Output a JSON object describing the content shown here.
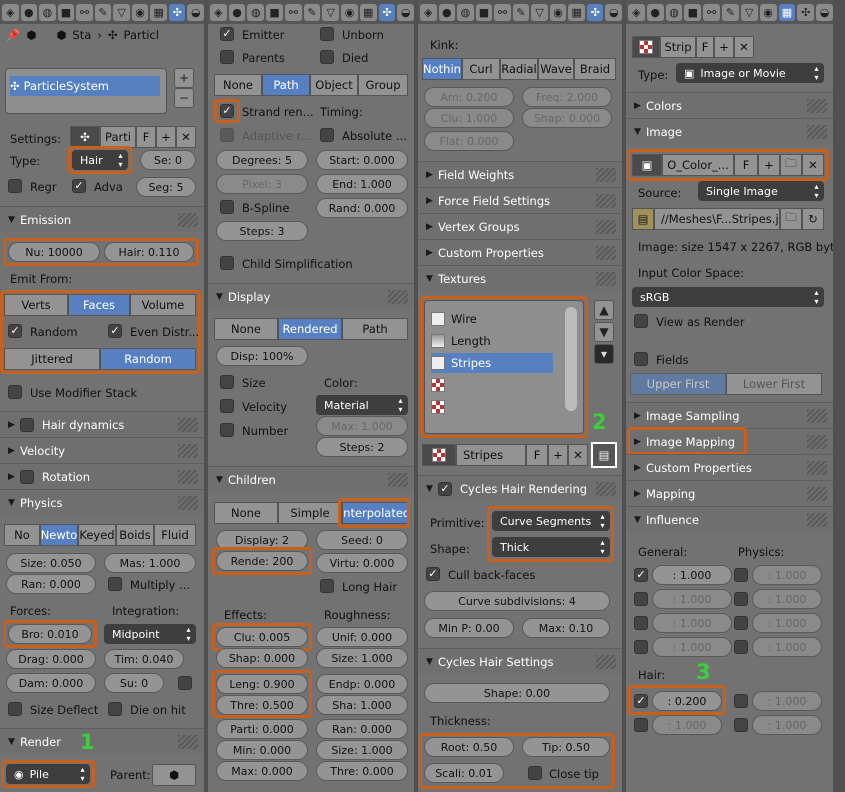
{
  "p1": {
    "breadcrumb": {
      "a": "Sta",
      "b": "Particl"
    },
    "list_item": "ParticleSystem",
    "settings_label": "Settings:",
    "settings_name": "Parti",
    "settings_f": "F",
    "type_label": "Type:",
    "type_value": "Hair",
    "se": "Se: 0",
    "regr": "Regr",
    "adva": "Adva",
    "seg": "Seg: 5",
    "emission": "Emission",
    "nu": "Nu: 10000",
    "hair": "Hair: 0.110",
    "emit_from": "Emit From:",
    "verts": "Verts",
    "faces": "Faces",
    "volume": "Volume",
    "random": "Random",
    "even": "Even Distr...",
    "jittered": "Jittered",
    "random2": "Random",
    "use_mod": "Use Modifier Stack",
    "hair_dyn": "Hair dynamics",
    "velocity": "Velocity",
    "rotation": "Rotation",
    "physics": "Physics",
    "ph_no": "No",
    "ph_newto": "Newto",
    "ph_keyed": "Keyed",
    "ph_boids": "Boids",
    "ph_fluid": "Fluid",
    "size": "Size: 0.050",
    "mas": "Mas: 1.000",
    "ran": "Ran: 0.000",
    "multiply": "Multiply ...",
    "forces": "Forces:",
    "integration": "Integration:",
    "bro": "Bro: 0.010",
    "midpoint": "Midpoint",
    "drag": "Drag: 0.000",
    "tim": "Tim: 0.040",
    "dam": "Dam: 0.000",
    "su": "Su: 0",
    "size_deflect": "Size Deflect",
    "die": "Die on hit",
    "render": "Render",
    "num1": "1",
    "pile": "Pile",
    "parent": "Parent:"
  },
  "p2": {
    "emitter": "Emitter",
    "unborn": "Unborn",
    "parents": "Parents",
    "died": "Died",
    "none": "None",
    "path": "Path",
    "object": "Object",
    "group": "Group",
    "strand": "Strand ren...",
    "timing": "Timing:",
    "adaptive": "Adaptive r...",
    "absolute": "Absolute ...",
    "degrees": "Degrees: 5",
    "start": "Start: 0.000",
    "pixel": "Pixel: 3",
    "end": "End: 1.000",
    "bspline": "B-Spline",
    "rand": "Rand: 0.000",
    "steps": "Steps: 3",
    "child_simp": "Child Simplification",
    "display": "Display",
    "d_none": "None",
    "d_rendered": "Rendered",
    "d_path": "Path",
    "disp": "Disp: 100%",
    "size": "Size",
    "color": "Color:",
    "velocity": "Velocity",
    "material": "Material",
    "max": "Max: 1.000",
    "number": "Number",
    "steps2": "Steps: 2",
    "children": "Children",
    "c_none": "None",
    "c_simple": "Simple",
    "c_interp": "Interpolated",
    "display2": "Display: 2",
    "seed": "Seed: 0",
    "rende": "Rende: 200",
    "virtu": "Virtu: 0.000",
    "long_hair": "Long Hair",
    "effects": "Effects:",
    "roughness": "Roughness:",
    "clu": "Clu: 0.005",
    "unif": "Unif: 0.000",
    "shap": "Shap: 0.000",
    "size2": "Size: 1.000",
    "leng": "Leng: 0.900",
    "endp": "Endp: 0.000",
    "thre": "Thre: 0.500",
    "sha": "Sha: 1.000",
    "parti": "Parti: 0.000",
    "ran": "Ran: 0.000",
    "min": "Min: 0.000",
    "size3": "Size: 1.000",
    "max2": "Max: 0.000",
    "thre2": "Thre: 0.000"
  },
  "p3": {
    "kink": "Kink:",
    "k_nothing": "Nothin",
    "k_curl": "Curl",
    "k_radial": "Radial",
    "k_wave": "Wave",
    "k_braid": "Braid",
    "am": "Am: 0.200",
    "freq": "Freq: 2.000",
    "clu": "Clu: 1.000",
    "shap": "Shap: 0.000",
    "flat": "Flat: 0.000",
    "field_weights": "Field Weights",
    "force_field": "Force Field Settings",
    "vertex_groups": "Vertex Groups",
    "custom_props": "Custom Properties",
    "textures": "Textures",
    "tex_items": [
      "Wire",
      "Length",
      "Stripes",
      "",
      ""
    ],
    "num2": "2",
    "tex_name": "Stripes",
    "tex_f": "F",
    "cycles_render": "Cycles Hair Rendering",
    "primitive": "Primitive:",
    "prim_val": "Curve Segments",
    "shape": "Shape:",
    "shape_val": "Thick",
    "cull": "Cull back-faces",
    "curve_subdiv": "Curve subdivisions: 4",
    "minp": "Min P: 0.00",
    "max": "Max: 0.10",
    "cycles_settings": "Cycles Hair Settings",
    "shape2": "Shape: 0.00",
    "thickness": "Thickness:",
    "root": "Root: 0.50",
    "tip": "Tip: 0.50",
    "scali": "Scali: 0.01",
    "close_tip": "Close tip"
  },
  "p4": {
    "tex": "Strip",
    "tex_f": "F",
    "type_label": "Type:",
    "type_val": "Image or Movie",
    "colors": "Colors",
    "image": "Image",
    "img_name": "O_Color_...",
    "img_f": "F",
    "source_label": "Source:",
    "source_val": "Single Image",
    "path": "//Meshes\\F...Stripes.jpg",
    "img_info": "Image: size 1547 x 2267, RGB byte",
    "input_cs": "Input Color Space:",
    "cs_val": "sRGB",
    "view_render": "View as Render",
    "fields": "Fields",
    "upper": "Upper First",
    "lower": "Lower First",
    "img_sampling": "Image Sampling",
    "img_mapping": "Image Mapping",
    "custom_props": "Custom Properties",
    "mapping": "Mapping",
    "influence": "Influence",
    "general": "General:",
    "physics": "Physics:",
    "v1": ": 1.000",
    "v2": ": 1.000",
    "v3": ": 1.000",
    "v4": ": 1.000",
    "v5": ": 1.000",
    "v6": ": 1.000",
    "v7": ": 1.000",
    "v8": ": 1.000",
    "hair": "Hair:",
    "num3": "3",
    "hair_val": ": 0.200",
    "v9": ": 1.000",
    "v10": ": 1.000",
    "v11": ": 1.000"
  },
  "colors": {
    "accent": "#5680c2",
    "highlight": "#c8601e",
    "number": "#3bd03b"
  }
}
